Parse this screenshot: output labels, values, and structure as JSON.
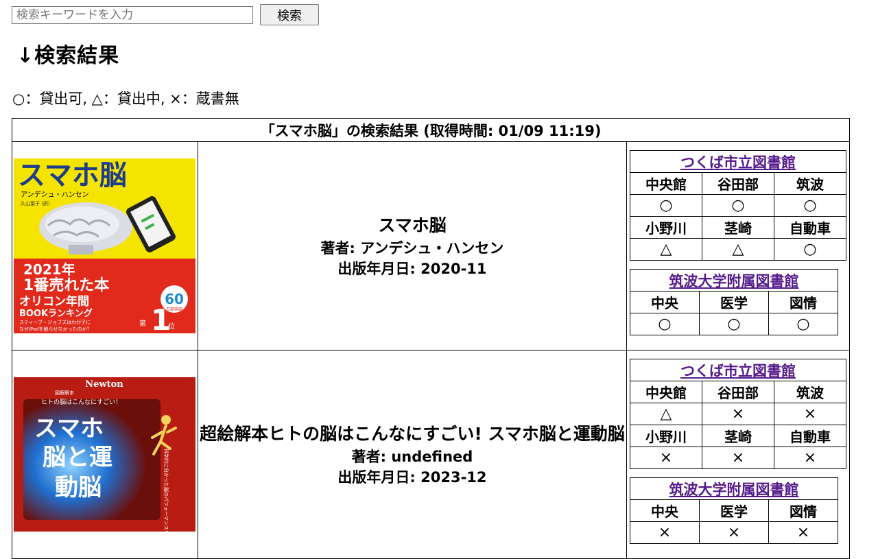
{
  "search": {
    "placeholder": "検索キーワードを入力",
    "button_label": "検索"
  },
  "heading": "↓検索結果",
  "legend": "○：貸出可, △：貸出中, ×：蔵書無",
  "results": {
    "caption": "「スマホ脳」の検索結果 (取得時間: 01/09 11:19)",
    "books": [
      {
        "title": "スマホ脳",
        "author": "著者: アンデシュ・ハンセン",
        "published": "出版年月日: 2020-11",
        "cover": {
          "title": "スマホ脳",
          "author": "アンデシュ・ハンセン",
          "translator": "久山葉子 (訳)",
          "banner_year": "2021年",
          "banner_line1": "1番売れた本",
          "banner_line2": "オリコン年間",
          "banner_line3": "BOOKランキング",
          "badge_num": "60",
          "badge_sub": "万部突破",
          "rank_label": "第",
          "rank_num": "1",
          "rank_suffix": "位",
          "tagline_1": "スティーブ・ジョブズはわが子に",
          "tagline_2": "なぜiPadを触らせなかったのか？",
          "colors": {
            "top": "#f5e400",
            "bottom": "#e12a1c"
          }
        },
        "libraries": {
          "city": {
            "name": "つくば市立図書館",
            "branches": [
              "中央館",
              "谷田部",
              "筑波",
              "小野川",
              "茎崎",
              "自動車"
            ],
            "status": [
              "○",
              "○",
              "○",
              "△",
              "△",
              "○"
            ]
          },
          "univ": {
            "name": "筑波大学附属図書館",
            "branches": [
              "中央",
              "医学",
              "図情"
            ],
            "status": [
              "○",
              "○",
              "○"
            ]
          }
        }
      },
      {
        "title": "超絵解本ヒトの脳はこんなにすごい! スマホ脳と運動脳",
        "author": "著者: undefined",
        "published": "出版年月日: 2023-12",
        "cover": {
          "brand": "Newton",
          "series": "図解解本",
          "subtitle": "ヒトの脳はこんなにすごい！",
          "title_1": "スマホ",
          "title_2": "脳と運",
          "title_3": "動脳",
          "side_text": "科学的に分かった脳のパフォーマンスを高める",
          "colors": {
            "bg": "#b81c12",
            "glow": "#4fb3ff"
          }
        },
        "libraries": {
          "city": {
            "name": "つくば市立図書館",
            "branches": [
              "中央館",
              "谷田部",
              "筑波",
              "小野川",
              "茎崎",
              "自動車"
            ],
            "status": [
              "△",
              "×",
              "×",
              "×",
              "×",
              "×"
            ]
          },
          "univ": {
            "name": "筑波大学附属図書館",
            "branches": [
              "中央",
              "医学",
              "図情"
            ],
            "status": [
              "×",
              "×",
              "×"
            ]
          }
        }
      }
    ]
  }
}
